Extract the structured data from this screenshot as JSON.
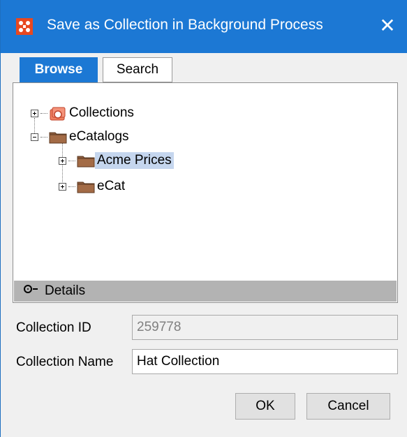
{
  "window": {
    "title": "Save as Collection in Background Process",
    "close_glyph": "✕",
    "app_icon": "app-logo-icon",
    "accent": "#1c78d4"
  },
  "tabs": [
    {
      "label": "Browse",
      "active": true
    },
    {
      "label": "Search",
      "active": false
    }
  ],
  "tree": [
    {
      "label": "Collections",
      "icon": "collections-icon",
      "expander": "plus",
      "level": 0
    },
    {
      "label": "eCatalogs",
      "icon": "folder-icon",
      "expander": "minus",
      "level": 0
    },
    {
      "label": "Acme Prices",
      "icon": "folder-icon",
      "expander": "plus",
      "level": 1,
      "selected": true
    },
    {
      "label": "eCat",
      "icon": "folder-icon",
      "expander": "plus",
      "level": 1
    }
  ],
  "details": {
    "label": "Details"
  },
  "form": {
    "collection_id_label": "Collection ID",
    "collection_id_value": "259778",
    "collection_name_label": "Collection Name",
    "collection_name_value": "Hat Collection"
  },
  "buttons": {
    "ok": "OK",
    "cancel": "Cancel"
  }
}
